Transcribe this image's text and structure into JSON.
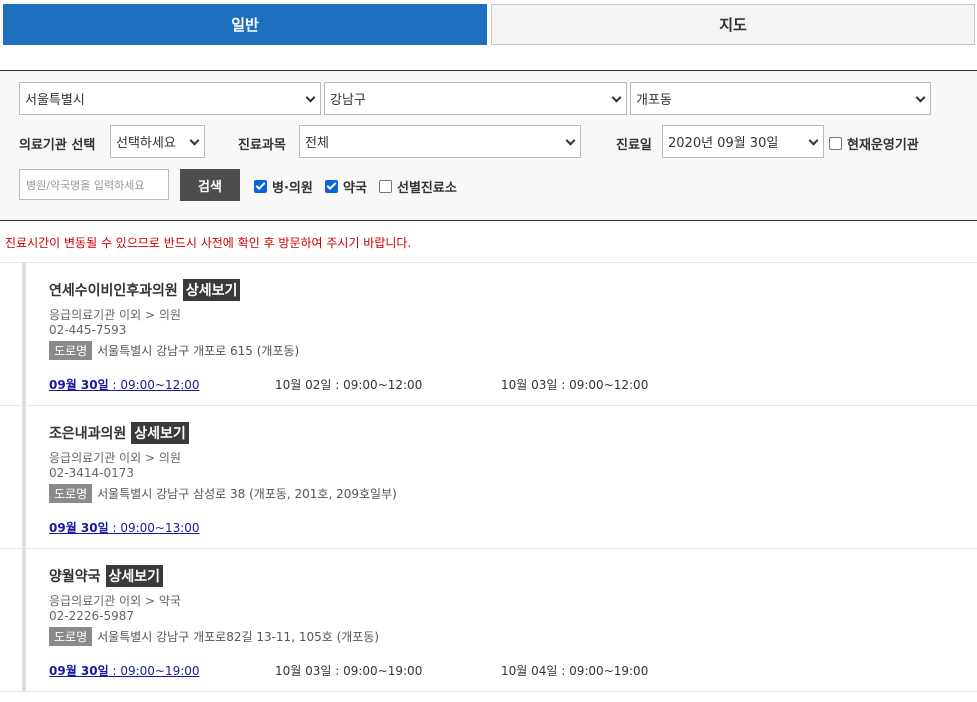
{
  "tabs": [
    {
      "label": "일반"
    },
    {
      "label": "지도"
    }
  ],
  "filter": {
    "city": "서울특별시",
    "district": "강남구",
    "dong": "개포동",
    "institution_label": "의료기관 선택",
    "institution_value": "선택하세요",
    "dept_label": "진료과목",
    "dept_value": "전체",
    "date_label": "진료일",
    "date_value": "2020년 09월 30일",
    "open_now": "현재운영기관",
    "search_placeholder": "병원/약국명을 입력하세요",
    "search_button": "검색",
    "chk_clinic": "병·의원",
    "chk_pharmacy": "약국",
    "chk_screening": "선별진료소"
  },
  "notice": "진료시간이 변동될 수 있으므로 반드시 사전에 확인 후 방문하여 주시기 바랍니다.",
  "detail_label": "상세보기",
  "road_label": "도로명",
  "items": [
    {
      "name": "연세수이비인후과의원",
      "type": "응급의료기관 이외 > 의원",
      "phone": "02-445-7593",
      "address": "서울특별시 강남구 개포로 615 (개포동)",
      "hours": [
        {
          "date": "09월 30일",
          "time": " : 09:00~12:00"
        },
        {
          "date": "10월 02일",
          "time": " : 09:00~12:00"
        },
        {
          "date": "10월 03일",
          "time": " : 09:00~12:00"
        }
      ]
    },
    {
      "name": "조은내과의원",
      "type": "응급의료기관 이외 > 의원",
      "phone": "02-3414-0173",
      "address": "서울특별시 강남구 삼성로 38 (개포동, 201호, 209호일부)",
      "hours": [
        {
          "date": "09월 30일",
          "time": " : 09:00~13:00"
        }
      ]
    },
    {
      "name": "양월약국",
      "type": "응급의료기관 이외 > 약국",
      "phone": "02-2226-5987",
      "address": "서울특별시 강남구 개포로82길 13-11, 105호 (개포동)",
      "hours": [
        {
          "date": "09월 30일",
          "time": " : 09:00~19:00"
        },
        {
          "date": "10월 03일",
          "time": " : 09:00~19:00"
        },
        {
          "date": "10월 04일",
          "time": " : 09:00~19:00"
        }
      ]
    }
  ]
}
